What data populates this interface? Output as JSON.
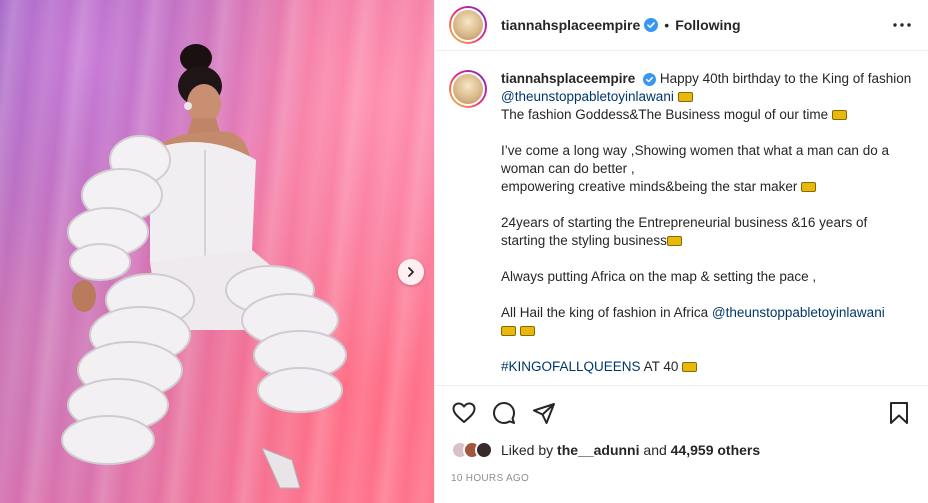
{
  "post": {
    "username": "tiannahsplaceempire",
    "separator": "•",
    "follow_status": "Following",
    "more_icon": "more-horizontal-icon",
    "verified_color": "#3897f0"
  },
  "caption": {
    "username": "tiannahsplaceempire",
    "line1": "Happy 40th birthday to the King of fashion",
    "mention1": "@theunstoppabletoyinlawani",
    "line2": "The fashion Goddess&The Business mogul of our time",
    "line3a": "I’ve come a long way ,Showing women that what a man can do a",
    "line3b": "woman can do better ,",
    "line3c": "empowering creative minds&being the star maker",
    "line4a": "24years of starting the Entrepreneurial business &16 years of",
    "line4b": "starting the styling business",
    "line5": "Always putting Africa on the map & setting the pace ,",
    "line6": "All Hail the king of fashion in Africa",
    "mention2": "@theunstoppabletoyinlawani",
    "hashtag": "#KINGOFALLQUEENS",
    "line7_rest": "AT 40",
    "crown_icon": "crown-emoji-icon",
    "link_color": "#00376b"
  },
  "actions": {
    "like_icon": "heart-icon",
    "comment_icon": "comment-icon",
    "share_icon": "send-icon",
    "save_icon": "bookmark-icon"
  },
  "likes": {
    "prefix": "Liked by",
    "user": "the__adunni",
    "and": "and",
    "count": "44,959 others"
  },
  "timestamp": "10 HOURS AGO",
  "media": {
    "next_icon": "chevron-right-icon"
  }
}
